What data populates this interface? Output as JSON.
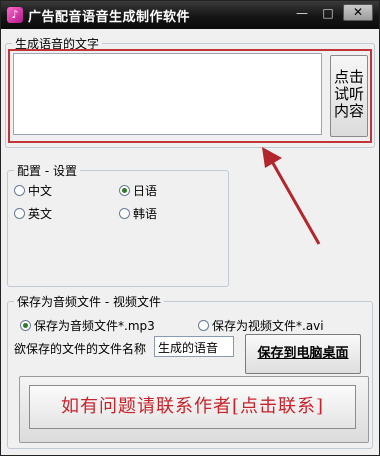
{
  "window": {
    "icon": "music-note-icon",
    "title": "广告配音语音生成制作软件",
    "minimize": "—",
    "maximize": "□",
    "close": "✕"
  },
  "text_group": {
    "legend": "生成语音的文字",
    "textarea_value": "",
    "listen_button": "点击试听内容"
  },
  "config_group": {
    "legend": "配置 - 设置",
    "options": [
      {
        "label": "中文",
        "selected": false
      },
      {
        "label": "日语",
        "selected": true
      },
      {
        "label": "英文",
        "selected": false
      },
      {
        "label": "韩语",
        "selected": false
      }
    ]
  },
  "save_group": {
    "legend": "保存为音频文件 - 视频文件",
    "audio_option": "保存为音频文件*.mp3",
    "audio_selected": true,
    "video_option": "保存为视频文件*.avi",
    "video_selected": false,
    "filename_label": "欲保存的文件的文件名称",
    "filename_value": "生成的语音",
    "save_button": "保存到电脑桌面",
    "contact_button": "如有问题请联系作者[点击联系]"
  },
  "colors": {
    "highlight": "#c0343a",
    "contact_text": "#c8232c"
  }
}
